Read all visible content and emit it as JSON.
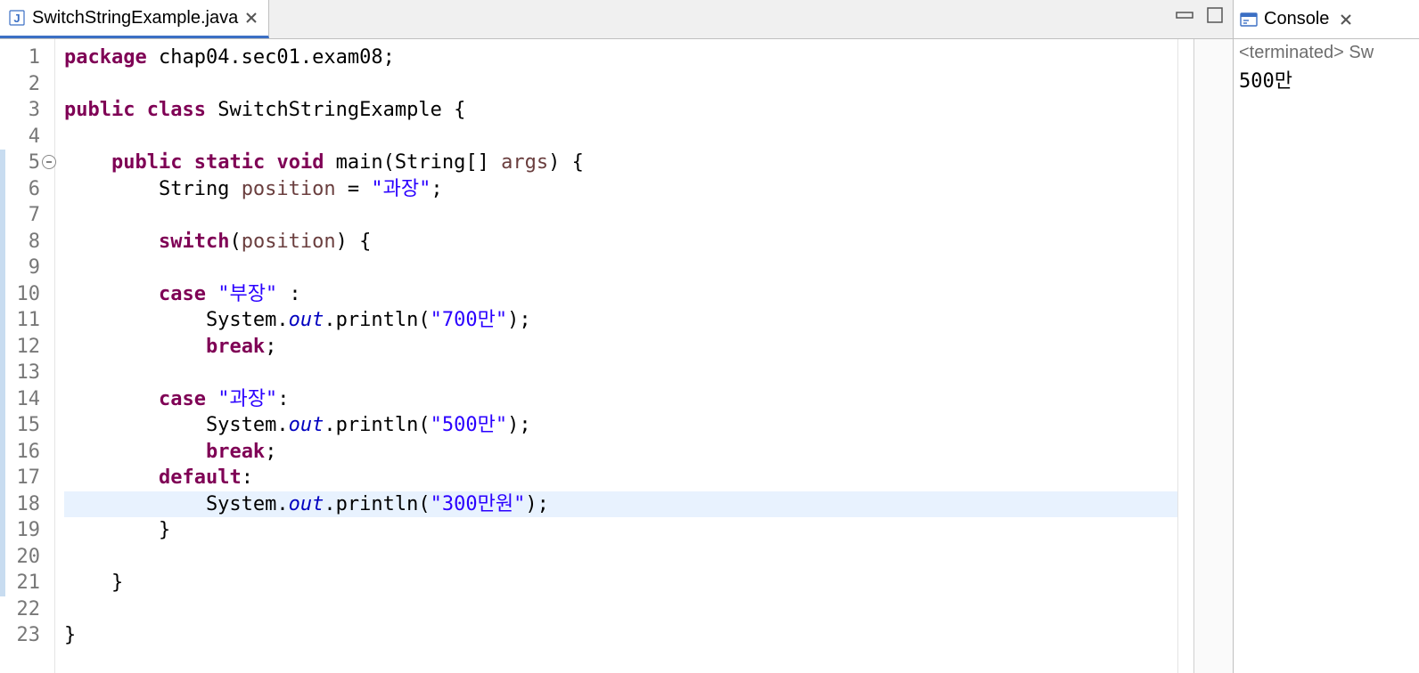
{
  "editor": {
    "tab": {
      "filename": "SwitchStringExample.java"
    },
    "line_count": 23,
    "fold_line": 5,
    "current_line": 18,
    "change_bar": {
      "from": 5,
      "to": 21
    },
    "code": [
      [
        [
          "kw",
          "package"
        ],
        [
          "plain",
          " chap04.sec01.exam08;"
        ]
      ],
      [],
      [
        [
          "kw",
          "public"
        ],
        [
          "plain",
          " "
        ],
        [
          "kw",
          "class"
        ],
        [
          "plain",
          " SwitchStringExample {"
        ]
      ],
      [],
      [
        [
          "plain",
          "    "
        ],
        [
          "kw",
          "public"
        ],
        [
          "plain",
          " "
        ],
        [
          "kw",
          "static"
        ],
        [
          "plain",
          " "
        ],
        [
          "kw",
          "void"
        ],
        [
          "plain",
          " main(String[] "
        ],
        [
          "var",
          "args"
        ],
        [
          "plain",
          ") {"
        ]
      ],
      [
        [
          "plain",
          "        String "
        ],
        [
          "var",
          "position"
        ],
        [
          "plain",
          " = "
        ],
        [
          "str",
          "\"과장\""
        ],
        [
          "plain",
          ";"
        ]
      ],
      [],
      [
        [
          "plain",
          "        "
        ],
        [
          "kw",
          "switch"
        ],
        [
          "plain",
          "("
        ],
        [
          "var",
          "position"
        ],
        [
          "plain",
          ") {"
        ]
      ],
      [],
      [
        [
          "plain",
          "        "
        ],
        [
          "kw",
          "case"
        ],
        [
          "plain",
          " "
        ],
        [
          "str",
          "\"부장\""
        ],
        [
          "plain",
          " :"
        ]
      ],
      [
        [
          "plain",
          "            System."
        ],
        [
          "fld",
          "out"
        ],
        [
          "plain",
          ".println("
        ],
        [
          "str",
          "\"700만\""
        ],
        [
          "plain",
          ");"
        ]
      ],
      [
        [
          "plain",
          "            "
        ],
        [
          "kw",
          "break"
        ],
        [
          "plain",
          ";"
        ]
      ],
      [],
      [
        [
          "plain",
          "        "
        ],
        [
          "kw",
          "case"
        ],
        [
          "plain",
          " "
        ],
        [
          "str",
          "\"과장\""
        ],
        [
          "plain",
          ":"
        ]
      ],
      [
        [
          "plain",
          "            System."
        ],
        [
          "fld",
          "out"
        ],
        [
          "plain",
          ".println("
        ],
        [
          "str",
          "\"500만\""
        ],
        [
          "plain",
          ");"
        ]
      ],
      [
        [
          "plain",
          "            "
        ],
        [
          "kw",
          "break"
        ],
        [
          "plain",
          ";"
        ]
      ],
      [
        [
          "plain",
          "        "
        ],
        [
          "kw",
          "default"
        ],
        [
          "plain",
          ":"
        ]
      ],
      [
        [
          "plain",
          "            System."
        ],
        [
          "fld",
          "out"
        ],
        [
          "plain",
          ".println("
        ],
        [
          "str",
          "\"300만원\""
        ],
        [
          "plain",
          ");"
        ]
      ],
      [
        [
          "plain",
          "        }"
        ]
      ],
      [],
      [
        [
          "plain",
          "    }"
        ]
      ],
      [],
      [
        [
          "plain",
          "}"
        ]
      ]
    ]
  },
  "console": {
    "title": "Console",
    "status": "<terminated> Sw",
    "output": "500만"
  }
}
